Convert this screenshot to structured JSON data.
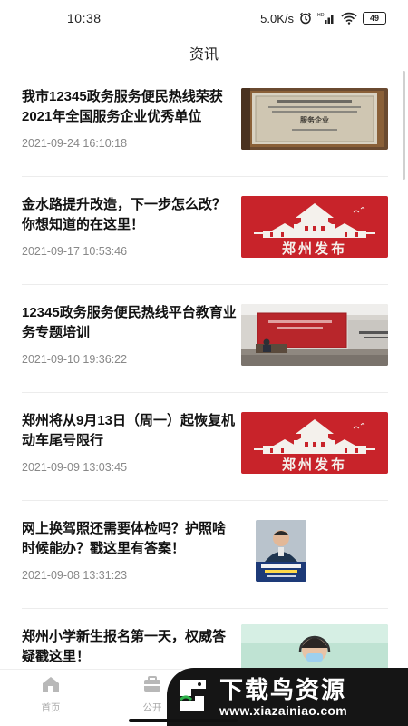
{
  "status_bar": {
    "time": "10:38",
    "speed": "5.0K/s",
    "battery": "49",
    "icons": [
      "alarm-icon",
      "hd-signal-icon",
      "wifi-icon",
      "battery-icon"
    ]
  },
  "header": {
    "title": "资讯"
  },
  "news": [
    {
      "title": "我市12345政务服务便民热线荣获2021年全国服务企业优秀单位",
      "date": "2021-09-24 16:10:18",
      "image": "award-plaque-photo",
      "plaque_text": "服务企业"
    },
    {
      "title": "金水路提升改造，下一步怎么改？你想知道的在这里！",
      "date": "2021-09-17 10:53:46",
      "image": "zhengzhou-release-banner",
      "banner_text": "郑州发布"
    },
    {
      "title": "12345政务服务便民热线平台教育业务专题培训",
      "date": "2021-09-10 19:36:22",
      "image": "training-room-photo"
    },
    {
      "title": "郑州将从9月13日（周一）起恢复机动车尾号限行",
      "date": "2021-09-09 13:03:45",
      "image": "zhengzhou-release-banner",
      "banner_text": "郑州发布"
    },
    {
      "title": "网上换驾照还需要体检吗？护照啥时候能办？戳这里有答案！",
      "date": "2021-09-08 13:31:23",
      "image": "officer-poster-photo"
    },
    {
      "title": "郑州小学新生报名第一天，权威答疑戳这里！",
      "date": "",
      "image": "operator-headset-photo"
    }
  ],
  "tabbar": {
    "tabs": [
      {
        "label": "首页",
        "icon": "home-icon"
      },
      {
        "label": "公开",
        "icon": "public-icon"
      }
    ]
  },
  "watermark": {
    "name": "下载鸟资源",
    "url": "www.xiazainiao.com"
  },
  "colors": {
    "banner_red": "#c8232a",
    "date_gray": "#888888",
    "tab_gray": "#aaaaaa"
  }
}
